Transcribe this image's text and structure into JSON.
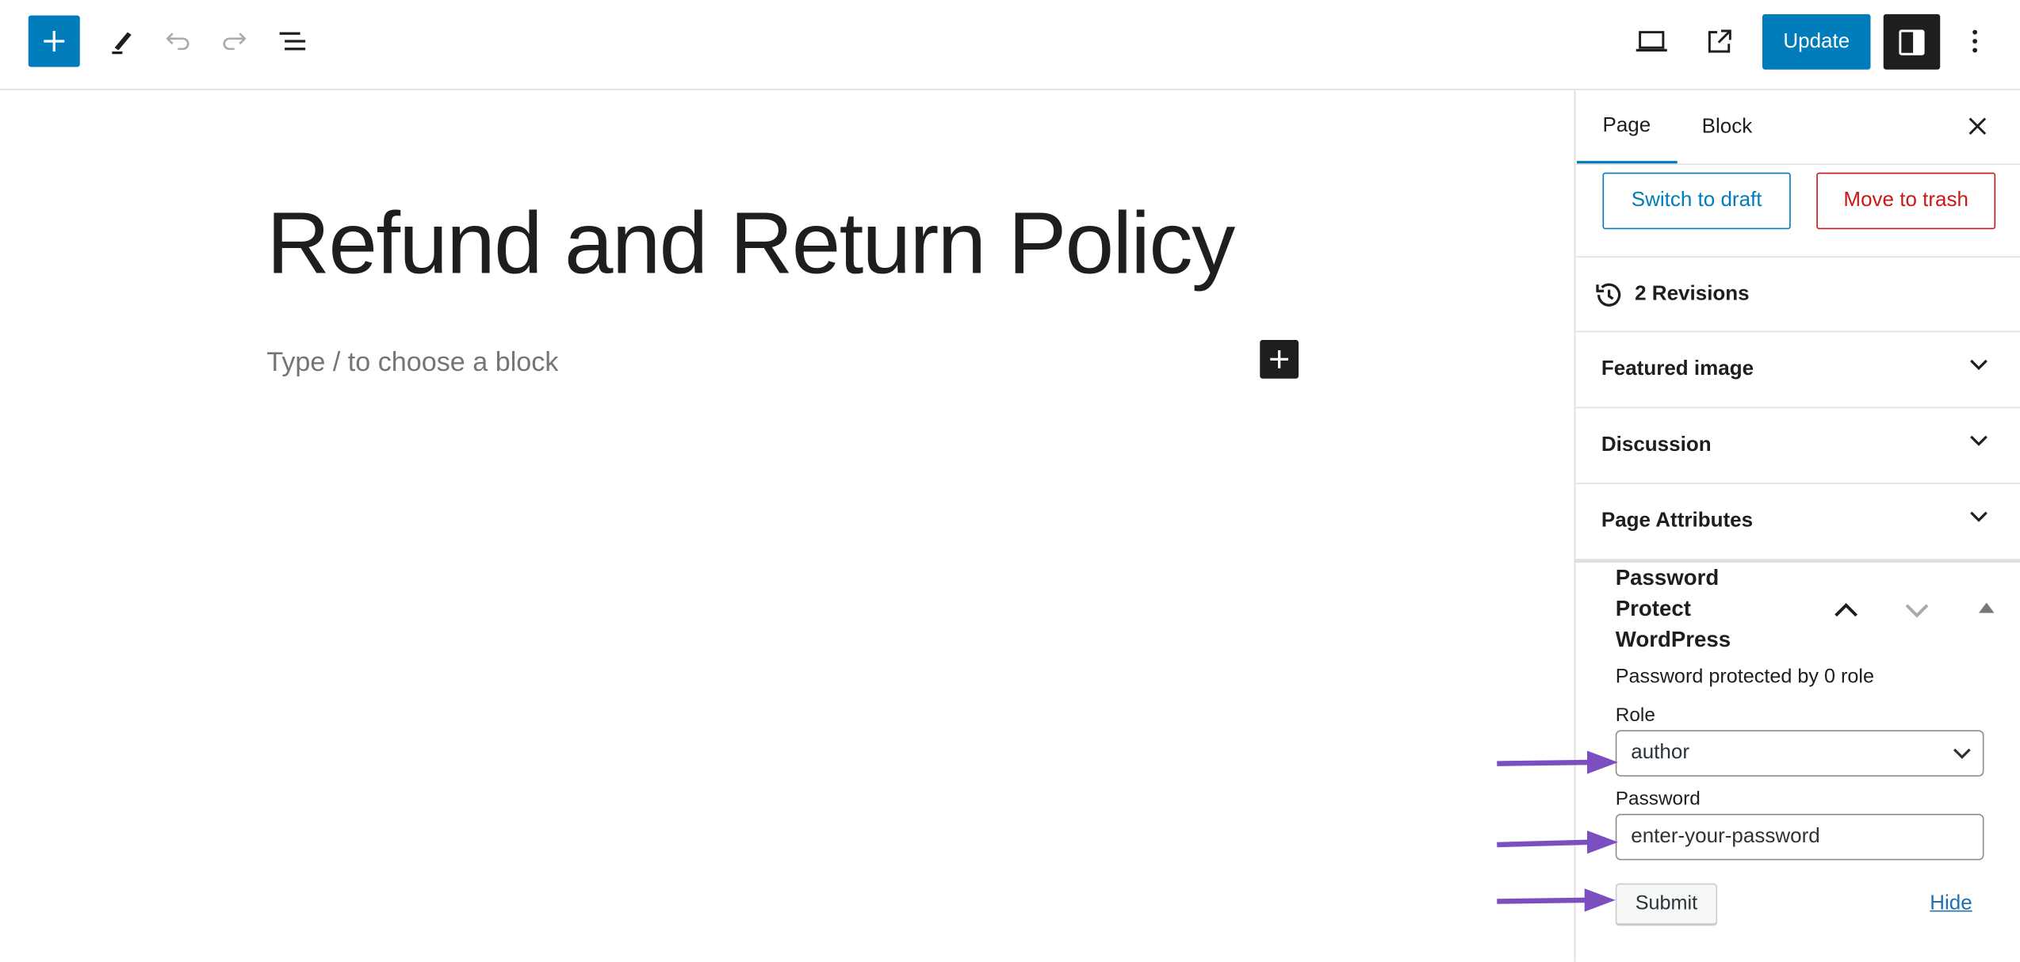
{
  "toolbar": {
    "update_label": "Update",
    "icons": [
      "plus-icon",
      "pen-icon",
      "undo-icon",
      "redo-icon",
      "list-view-icon",
      "laptop-preview-icon",
      "external-link-icon",
      "sidebar-toggle-icon",
      "more-options-icon"
    ]
  },
  "editor": {
    "title": "Refund and Return Policy",
    "placeholder": "Type / to choose a block"
  },
  "sidebar": {
    "tabs": [
      {
        "label": "Page",
        "active": true
      },
      {
        "label": "Block",
        "active": false
      }
    ],
    "switch_to_draft": "Switch to draft",
    "move_to_trash": "Move to trash",
    "revisions": "2 Revisions",
    "panels": [
      "Featured image",
      "Discussion",
      "Page Attributes"
    ],
    "password_protect": {
      "title_lines": [
        "Password",
        "Protect",
        "WordPress"
      ],
      "status": "Password protected by 0 role",
      "role_label": "Role",
      "role_value": "author",
      "password_label": "Password",
      "password_value": "enter-your-password",
      "submit_label": "Submit",
      "hide_label": "Hide"
    }
  },
  "colors": {
    "accent": "#007cba",
    "danger": "#cc1818",
    "annotation_arrow": "#7b4fc0"
  }
}
